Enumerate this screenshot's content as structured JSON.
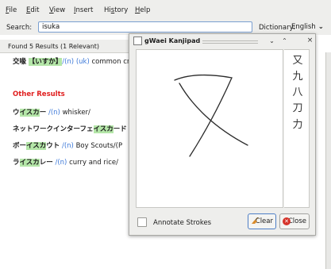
{
  "menubar": {
    "items": [
      {
        "label": "File",
        "key": "F"
      },
      {
        "label": "Edit",
        "key": "E"
      },
      {
        "label": "View",
        "key": "V"
      },
      {
        "label": "Insert",
        "key": "I"
      },
      {
        "label": "History",
        "key": "s"
      },
      {
        "label": "Help",
        "key": "H"
      }
    ]
  },
  "search": {
    "label": "Search:",
    "value": "isuka",
    "dictionary_label": "Dictionary:",
    "dictionary_value": "English"
  },
  "results": {
    "header": "Found 5 Results (1 Relevant)",
    "relevant": {
      "jp_prefix": "交喙",
      "jp_reading": "【いすか】",
      "tags": "/(n) (uk)",
      "gloss": " common cro"
    },
    "other_heading": "Other Results",
    "rows": [
      {
        "pre": "ウ",
        "hl": "イスカ",
        "post": "ー",
        "tags": "/(n)",
        "gloss": " whisker/"
      },
      {
        "pre": "ネットワークインターフェ",
        "hl": "イスカ",
        "post": "ード",
        "tags": "",
        "gloss": ""
      },
      {
        "pre": "ボー",
        "hl": "イスカ",
        "post": "ウト",
        "tags": "/(n)",
        "gloss": " Boy Scouts/(P"
      },
      {
        "pre": "ラ",
        "hl": "イスカ",
        "post": "レー",
        "tags": "/(n)",
        "gloss": " curry and rice/"
      }
    ]
  },
  "kanjipad": {
    "title": "gWaei Kanjipad",
    "candidates": [
      "又",
      "九",
      "八",
      "刀",
      "力"
    ],
    "annotate_label": "Annotate Strokes",
    "clear_label": "Clear",
    "close_label": "Close"
  }
}
